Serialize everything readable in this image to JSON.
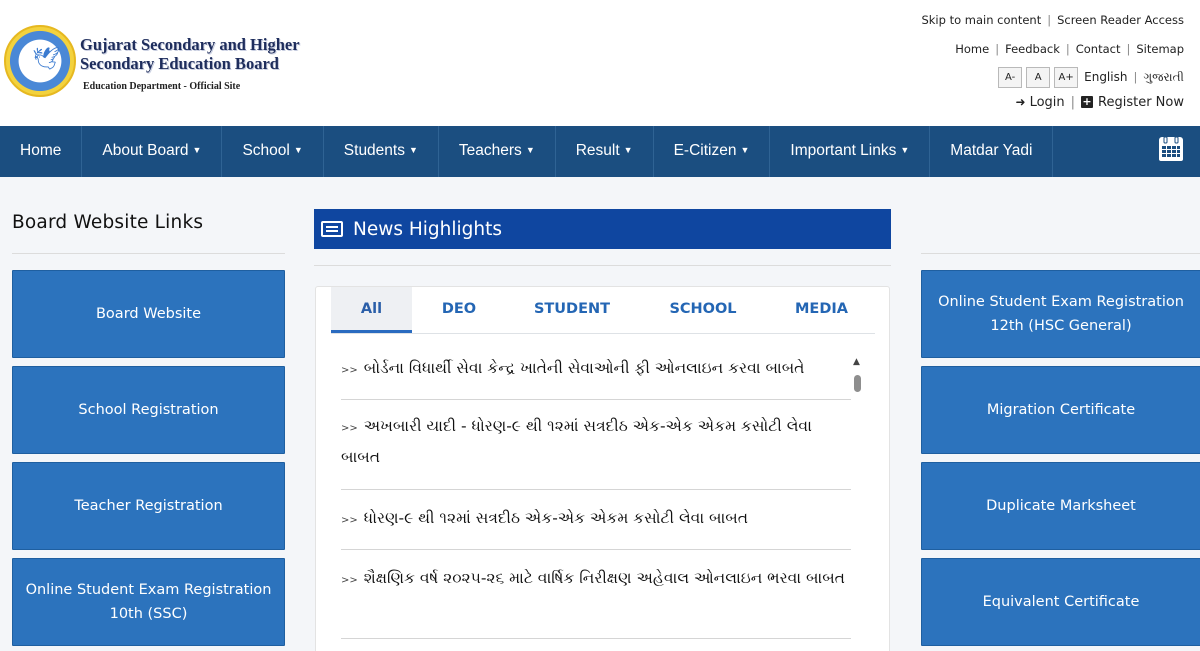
{
  "brand": {
    "line1": "Gujarat Secondary and Higher",
    "line2": "Secondary Education Board",
    "line3": "Education Department - Official Site",
    "logo_icon": "board-emblem-icon"
  },
  "toplinks": {
    "skip": "Skip to main content",
    "screen_reader": "Screen Reader Access",
    "home": "Home",
    "feedback": "Feedback",
    "contact": "Contact",
    "sitemap": "Sitemap",
    "font_minus": "A-",
    "font_normal": "A",
    "font_plus": "A+",
    "lang_en": "English",
    "lang_gu": "ગુજરાતી",
    "login": "Login",
    "register": "Register Now"
  },
  "nav": {
    "items": [
      {
        "label": "Home",
        "dropdown": false
      },
      {
        "label": "About Board",
        "dropdown": true
      },
      {
        "label": "School",
        "dropdown": true
      },
      {
        "label": "Students",
        "dropdown": true
      },
      {
        "label": "Teachers",
        "dropdown": true
      },
      {
        "label": "Result",
        "dropdown": true
      },
      {
        "label": "E-Citizen",
        "dropdown": true
      },
      {
        "label": "Important Links",
        "dropdown": true
      },
      {
        "label": "Matdar Yadi",
        "dropdown": false
      }
    ],
    "calendar_icon": "calendar-icon",
    "bg_color": "#1b4e80"
  },
  "left": {
    "title": "Board Website Links",
    "tiles": [
      "Board Website",
      "School Registration",
      "Teacher Registration",
      "Online Student Exam Registration 10th (SSC)"
    ]
  },
  "news": {
    "title": "News Highlights",
    "tabs": [
      "All",
      "DEO",
      "STUDENT",
      "SCHOOL",
      "MEDIA"
    ],
    "active_tab": "All",
    "items": [
      "બોર્ડના વિધાર્થી સેવા કેન્દ્ર ખાતેની સેવાઓની ફી ઓનલાઇન કરવા બાબતે",
      "અખબારી યાદી - ધોરણ-૯ થી ૧૨માં સત્રદીઠ એક-એક એકમ કસોટી લેવા બાબત",
      "ધોરણ-૯ થી ૧૨માં સત્રદીઠ એક-એક એકમ કસોટી લેવા બાબત",
      "શૈક્ષણિક વર્ષ ૨૦૨૫-૨૬ માટે વાર્ષિક નિરીક્ષણ અહેવાલ ઓનલાઇન ભરવા બાબત"
    ],
    "header_color": "#0f46a0"
  },
  "right": {
    "tiles": [
      "Online Student Exam Registration 12th (HSC General)",
      "Migration Certificate",
      "Duplicate Marksheet",
      "Equivalent Certificate"
    ]
  },
  "colors": {
    "tile": "#2c73bd",
    "accent": "#2466b4"
  }
}
